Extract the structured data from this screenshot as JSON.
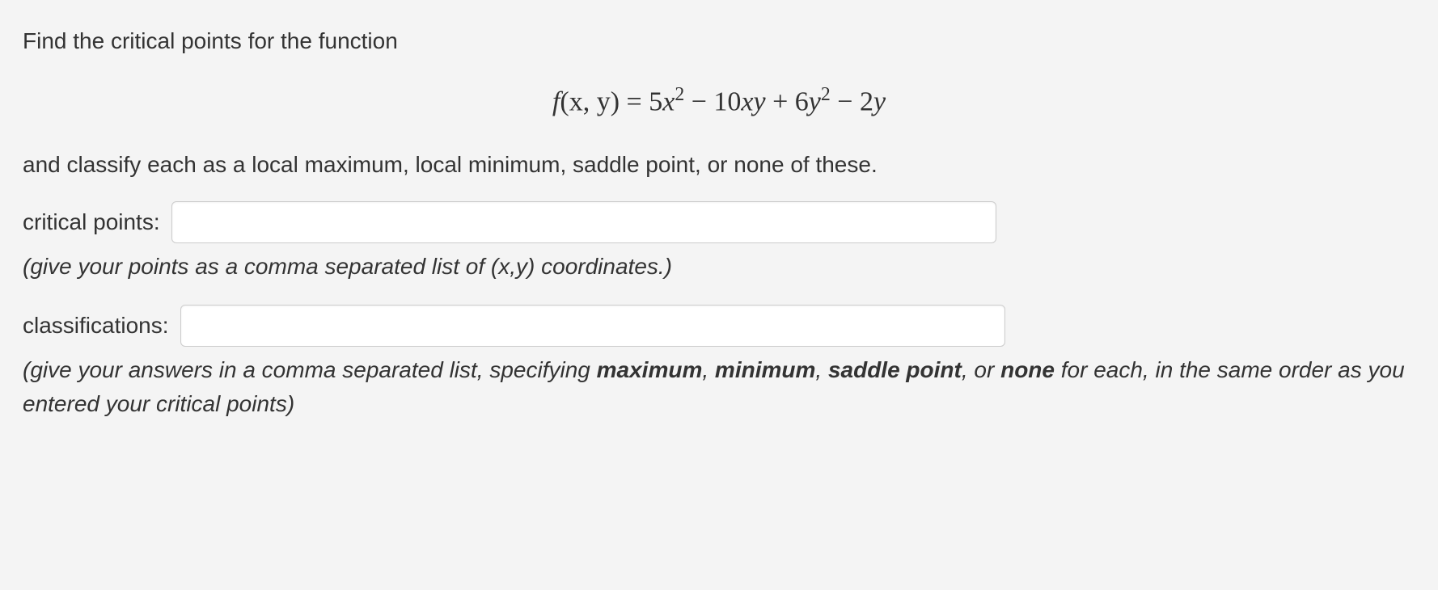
{
  "prompt": {
    "intro_line": "Find the critical points for the function",
    "classify_line": "and classify each as a local maximum, local minimum, saddle point, or none of these."
  },
  "equation": {
    "lhs_fn": "f",
    "lhs_args": "(x, y)",
    "eq_sign": " = ",
    "t1_coef": "5",
    "t1_var": "x",
    "t1_exp": "2",
    "op1": " − ",
    "t2_coef": "10",
    "t2_var": "xy",
    "op2": " + ",
    "t3_coef": "6",
    "t3_var": "y",
    "t3_exp": "2",
    "op3": " − ",
    "t4_coef": "2",
    "t4_var": "y"
  },
  "fields": {
    "critical_points": {
      "label": "critical points:",
      "value": ""
    },
    "classifications": {
      "label": "classifications:",
      "value": ""
    }
  },
  "hints": {
    "points_hint": "(give your points as a comma separated list of (x,y) coordinates.)",
    "class_hint_prefix": "(give your answers in a comma separated list, specifying ",
    "class_hint_kw1": "maximum",
    "class_hint_sep1": ", ",
    "class_hint_kw2": "minimum",
    "class_hint_sep2": ", ",
    "class_hint_kw3": "saddle point",
    "class_hint_sep3": ", or ",
    "class_hint_kw4": "none",
    "class_hint_suffix": " for each, in the same order as you entered your critical points)"
  }
}
